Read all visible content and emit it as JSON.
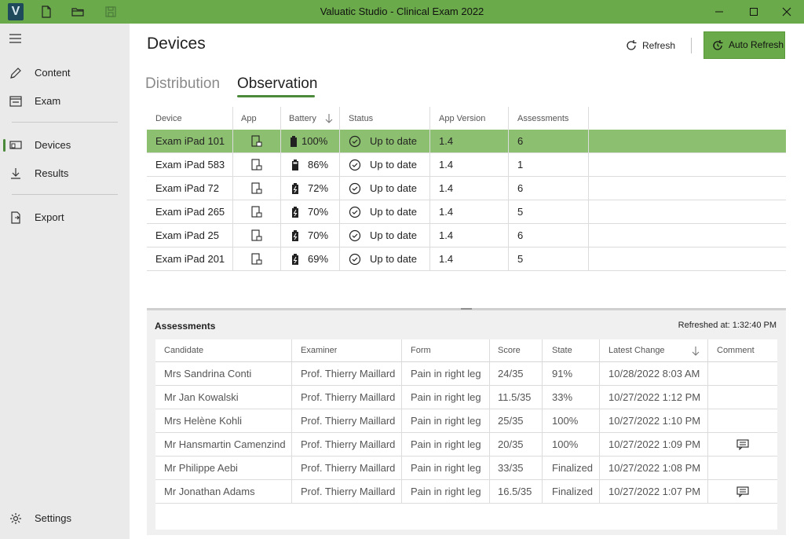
{
  "app": {
    "title": "Valuatic Studio - Clinical Exam 2022",
    "logo_letter": "V"
  },
  "sidebar": {
    "items": [
      {
        "label": "Content",
        "icon": "pencil-icon"
      },
      {
        "label": "Exam",
        "icon": "exam-icon"
      },
      {
        "label": "Devices",
        "icon": "devices-icon"
      },
      {
        "label": "Results",
        "icon": "download-arrow-icon"
      },
      {
        "label": "Export",
        "icon": "export-icon"
      }
    ],
    "settings_label": "Settings"
  },
  "header": {
    "title": "Devices",
    "refresh_label": "Refresh",
    "auto_refresh_label": "Auto Refresh"
  },
  "tabs": [
    {
      "label": "Distribution"
    },
    {
      "label": "Observation"
    }
  ],
  "devices": {
    "columns": [
      "Device",
      "App",
      "Battery",
      "Status",
      "App Version",
      "Assessments"
    ],
    "rows": [
      {
        "device": "Exam iPad 101",
        "battery": "100%",
        "status": "Up to date",
        "version": "1.4",
        "assessments": "6"
      },
      {
        "device": "Exam iPad 583",
        "battery": "86%",
        "status": "Up to date",
        "version": "1.4",
        "assessments": "1"
      },
      {
        "device": "Exam iPad 72",
        "battery": "72%",
        "status": "Up to date",
        "version": "1.4",
        "assessments": "6"
      },
      {
        "device": "Exam iPad 265",
        "battery": "70%",
        "status": "Up to date",
        "version": "1.4",
        "assessments": "5"
      },
      {
        "device": "Exam iPad 25",
        "battery": "70%",
        "status": "Up to date",
        "version": "1.4",
        "assessments": "6"
      },
      {
        "device": "Exam iPad 201",
        "battery": "69%",
        "status": "Up to date",
        "version": "1.4",
        "assessments": "5"
      }
    ]
  },
  "assessments": {
    "title": "Assessments",
    "refreshed": "Refreshed at: 1:32:40 PM",
    "columns": [
      "Candidate",
      "Examiner",
      "Form",
      "Score",
      "State",
      "Latest Change",
      "Comment"
    ],
    "rows": [
      {
        "candidate": "Mrs Sandrina Conti",
        "examiner": "Prof. Thierry Maillard",
        "form": "Pain in right leg",
        "score": "24/35",
        "state": "91%",
        "latest": "10/28/2022 8:03 AM",
        "has_comment": false
      },
      {
        "candidate": "Mr Jan Kowalski",
        "examiner": "Prof. Thierry Maillard",
        "form": "Pain in right leg",
        "score": "11.5/35",
        "state": "33%",
        "latest": "10/27/2022 1:12 PM",
        "has_comment": false
      },
      {
        "candidate": "Mrs Helène Kohli",
        "examiner": "Prof. Thierry Maillard",
        "form": "Pain in right leg",
        "score": "25/35",
        "state": "100%",
        "latest": "10/27/2022 1:10 PM",
        "has_comment": false
      },
      {
        "candidate": "Mr Hansmartin Camenzind",
        "examiner": "Prof. Thierry Maillard",
        "form": "Pain in right leg",
        "score": "20/35",
        "state": "100%",
        "latest": "10/27/2022 1:09 PM",
        "has_comment": true
      },
      {
        "candidate": "Mr Philippe Aebi",
        "examiner": "Prof. Thierry Maillard",
        "form": "Pain in right leg",
        "score": "33/35",
        "state": "Finalized",
        "latest": "10/27/2022 1:08 PM",
        "has_comment": false
      },
      {
        "candidate": "Mr Jonathan Adams",
        "examiner": "Prof. Thierry Maillard",
        "form": "Pain in right leg",
        "score": "16.5/35",
        "state": "Finalized",
        "latest": "10/27/2022 1:07 PM",
        "has_comment": true
      }
    ]
  },
  "colors": {
    "accent": "#6aaa4a",
    "selected_row": "#8dbf70",
    "sidebar_bg": "#eaeaea"
  }
}
